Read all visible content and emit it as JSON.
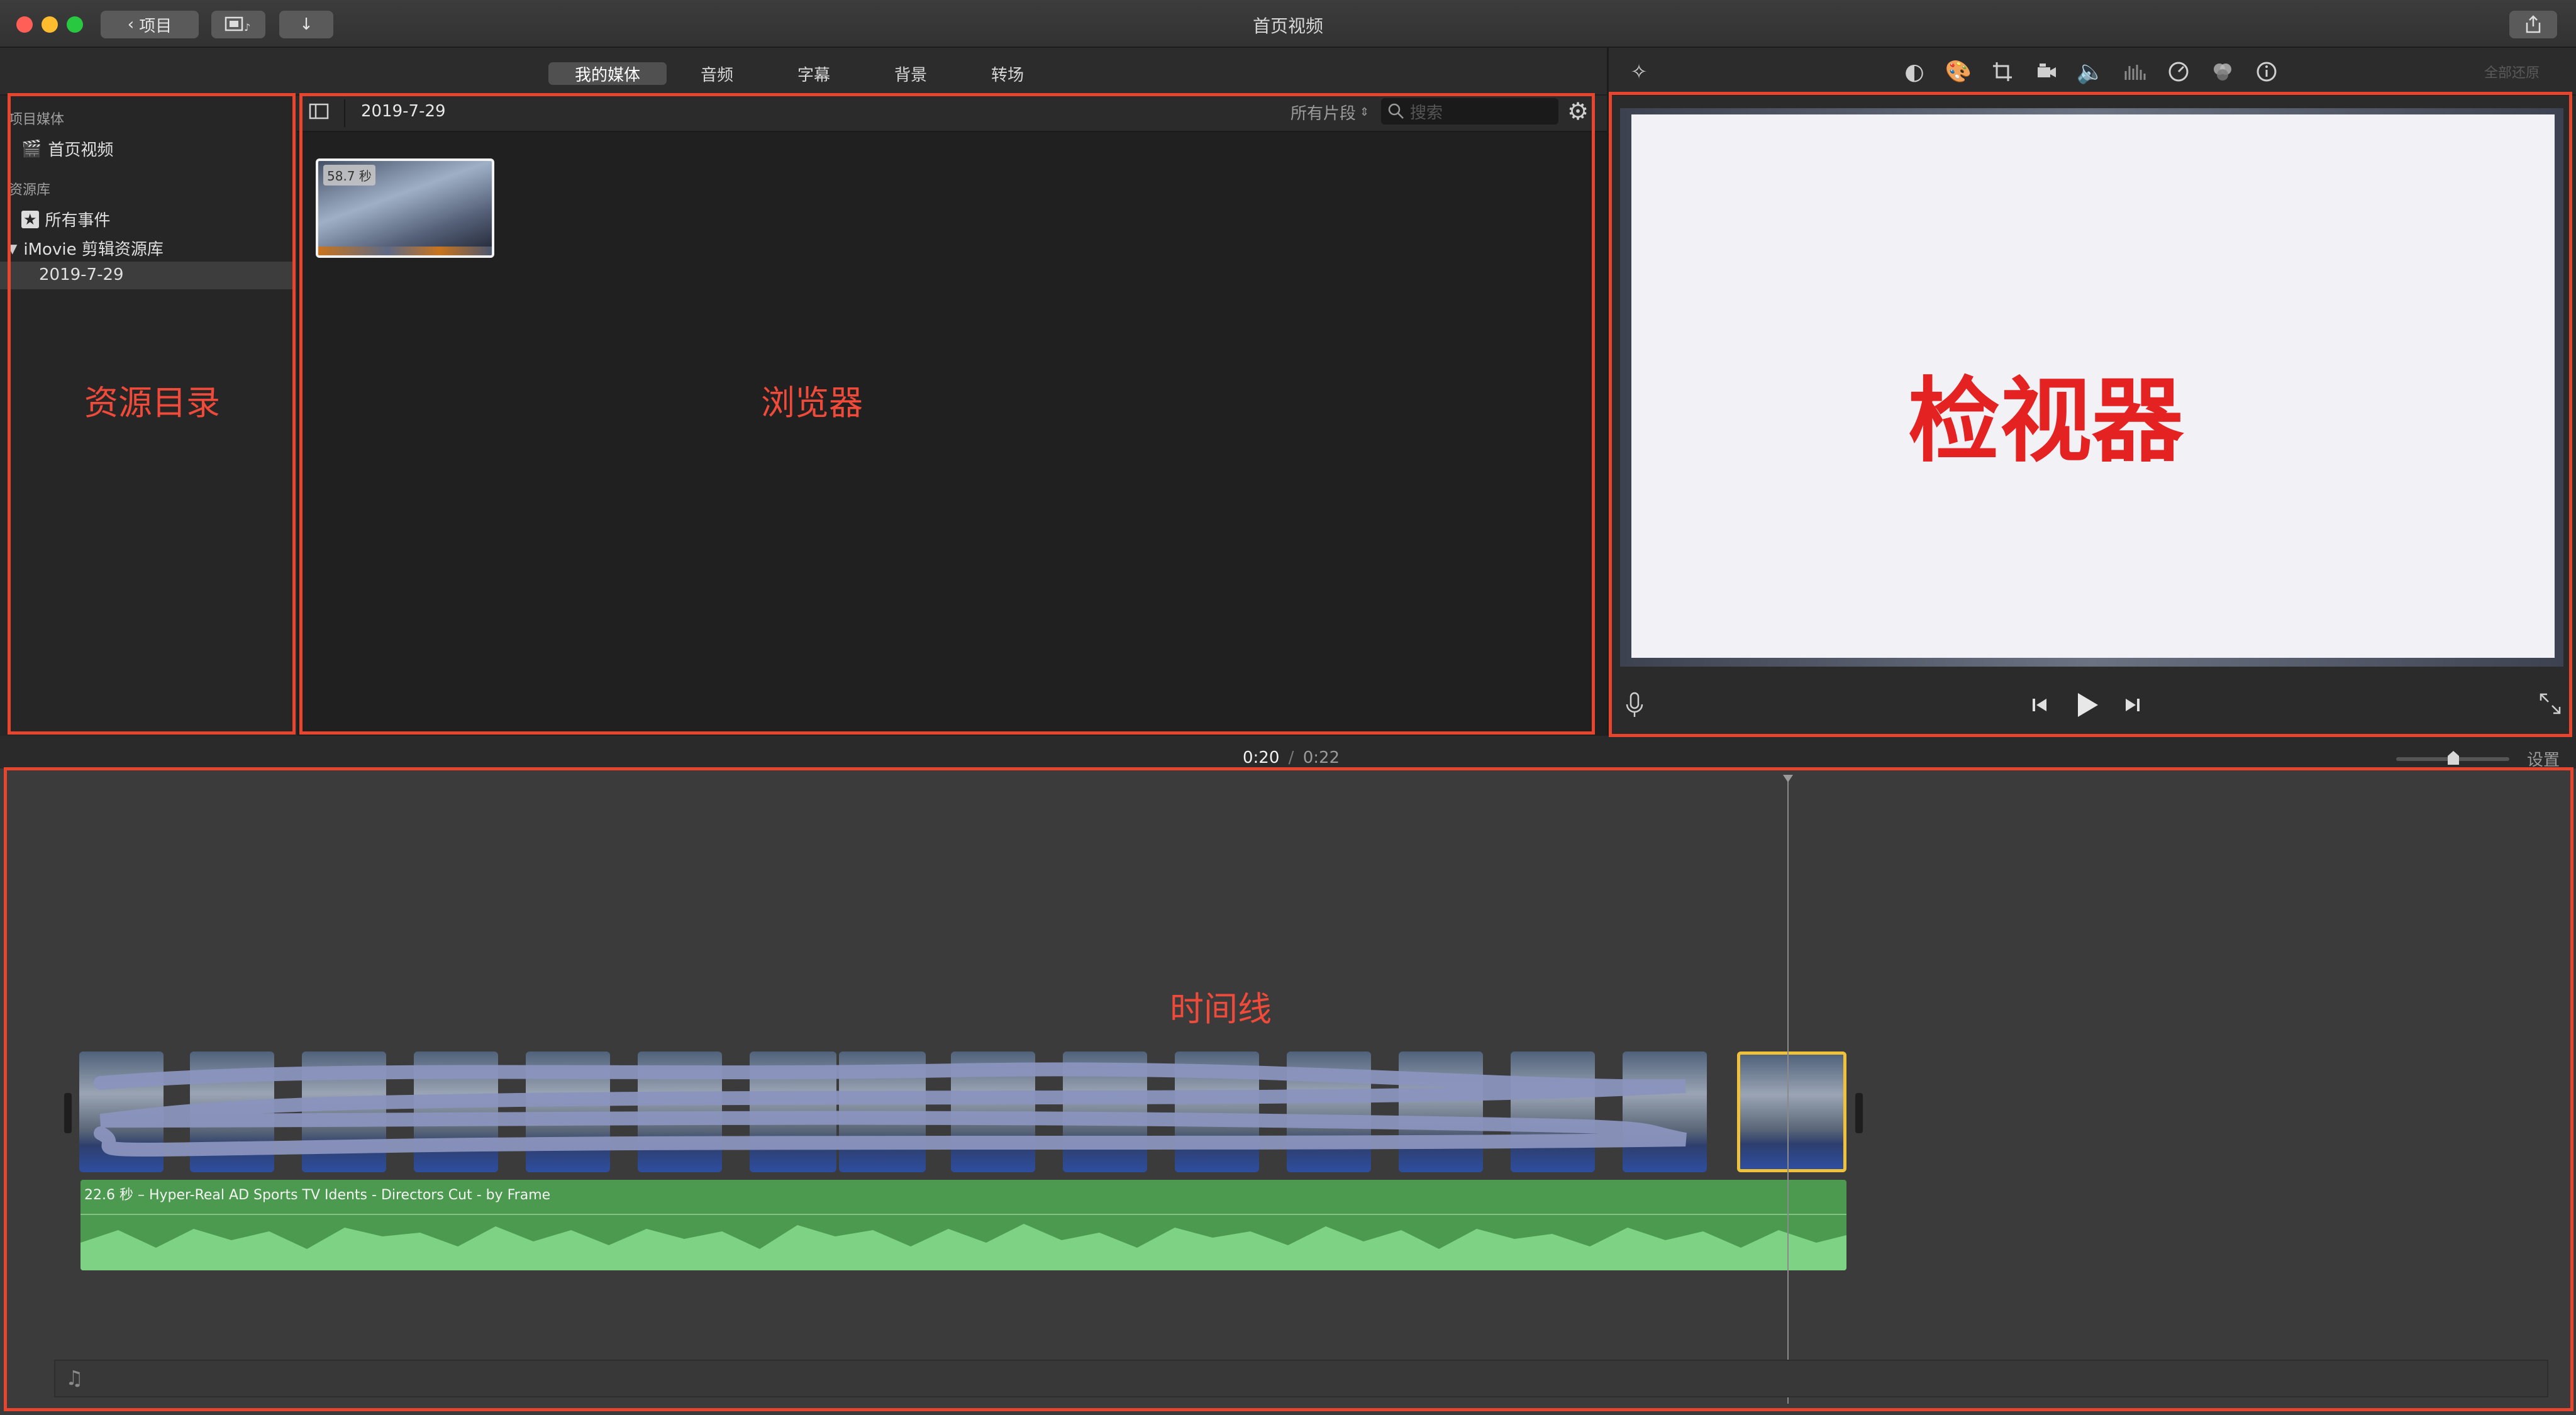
{
  "window": {
    "title": "首页视频",
    "back_label": "项目",
    "colors": {
      "close": "#ff5f57",
      "minimize": "#febc2e",
      "zoom": "#28c840",
      "annotation": "#e8452f",
      "audio": "#4c9a4f",
      "selection": "#f0c23a"
    }
  },
  "tabs": [
    {
      "label": "我的媒体",
      "active": true
    },
    {
      "label": "音频",
      "active": false
    },
    {
      "label": "字幕",
      "active": false
    },
    {
      "label": "背景",
      "active": false
    },
    {
      "label": "转场",
      "active": false
    }
  ],
  "toolbar": {
    "icons": [
      "magic-wand-icon",
      "color-balance-icon",
      "color-correction-icon",
      "crop-icon",
      "stabilization-icon",
      "volume-icon",
      "equalizer-icon",
      "speed-icon",
      "clip-filter-icon",
      "info-icon"
    ],
    "reset_all": "全部还原"
  },
  "library": {
    "project_media_heading": "项目媒体",
    "project_item": "首页视频",
    "libraries_heading": "资源库",
    "all_events": "所有事件",
    "library_name": "iMovie 剪辑资源库",
    "event": "2019-7-29"
  },
  "browser": {
    "event_title": "2019-7-29",
    "filter_label": "所有片段",
    "search_placeholder": "搜索",
    "clip_duration": "58.7 秒"
  },
  "timecode": {
    "current": "0:20",
    "total": "0:22",
    "separator": "/"
  },
  "settings_label": "设置",
  "audio_clip_label": "22.6 秒 – Hyper-Real AD Sports TV Idents - Directors Cut - by Frame",
  "annotations": {
    "library": "资源目录",
    "browser": "浏览器",
    "viewer": "检视器",
    "timeline": "时间线"
  }
}
